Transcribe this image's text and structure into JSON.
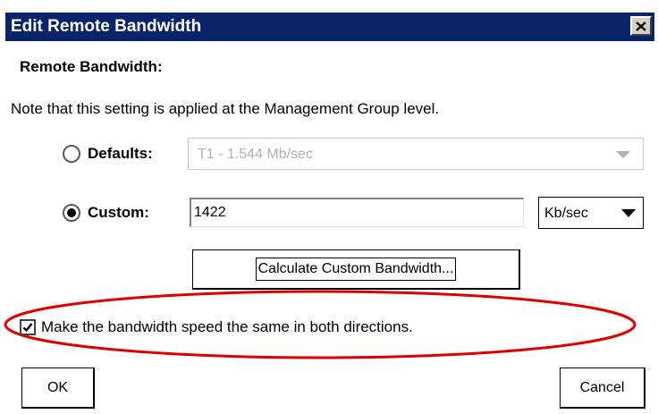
{
  "window": {
    "title": "Edit Remote Bandwidth"
  },
  "section": {
    "heading": "Remote Bandwidth:"
  },
  "note": "Note that this setting is applied at the Management Group level.",
  "defaults": {
    "label": "Defaults:",
    "selected": false,
    "select_value": "T1 - 1.544 Mb/sec",
    "enabled": false
  },
  "custom": {
    "label": "Custom:",
    "selected": true,
    "value": "1422",
    "unit": "Kb/sec"
  },
  "calculate_button": "Calculate Custom Bandwidth...",
  "same_directions": {
    "label": "Make the bandwidth speed the same in both directions.",
    "checked": true
  },
  "buttons": {
    "ok": "OK",
    "cancel": "Cancel"
  },
  "colors": {
    "titlebar": "#0a246a",
    "highlight_ellipse": "#e00000"
  },
  "icons": {
    "close": "close-icon",
    "checkmark": "checkmark-icon",
    "dropdown": "chevron-down-icon"
  }
}
